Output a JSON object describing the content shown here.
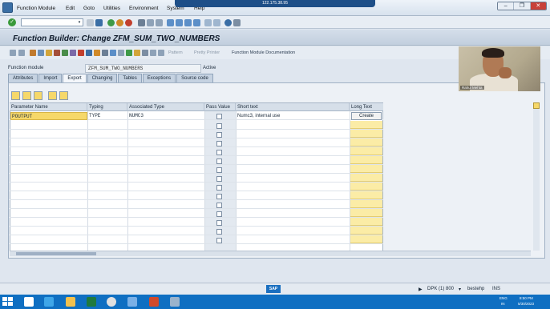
{
  "menu": {
    "items": [
      "Function Module",
      "Edit",
      "Goto",
      "Utilities",
      "Environment",
      "System",
      "Help"
    ]
  },
  "remote": {
    "title": "122.175.38.95"
  },
  "window": {
    "minimize": "–",
    "restore": "❐",
    "close": "✕"
  },
  "command_field": {
    "value": "",
    "dropdown": "▾"
  },
  "title": "Function Builder: Change ZFM_SUM_TWO_NUMBERS",
  "app_toolbar": {
    "pattern": "Pattern",
    "pretty_printer": "Pretty Printer",
    "docs": "Function Module Documentation"
  },
  "function_module": {
    "label": "Function module",
    "value": "ZFM_SUM_TWO_NUMBERS",
    "status": "Active"
  },
  "tabs": [
    "Attributes",
    "Import",
    "Export",
    "Changing",
    "Tables",
    "Exceptions",
    "Source code"
  ],
  "active_tab": 2,
  "grid": {
    "headers": [
      "Parameter Name",
      "Typing",
      "Associated Type",
      "Pass Value",
      "Short text",
      "Long Text"
    ],
    "rows": [
      {
        "param": "POUTPUT",
        "typing": "TYPE",
        "assoc": "NUMC3",
        "short": "Numc3, internal use",
        "long": "Create"
      }
    ]
  },
  "webcam": {
    "name": "Rahul Mehta"
  },
  "status": {
    "sap": "SAP",
    "system": "DPK (1) 800",
    "host": "bestehp",
    "mode": "INS"
  },
  "tray": {
    "lang": "ENG",
    "region": "IN",
    "time": "8:50 PM",
    "date": "5/30/2023"
  },
  "colors": {
    "accent": "#1e4f88",
    "taskbar": "#0f6fc2",
    "highlight": "#f6d86a"
  }
}
